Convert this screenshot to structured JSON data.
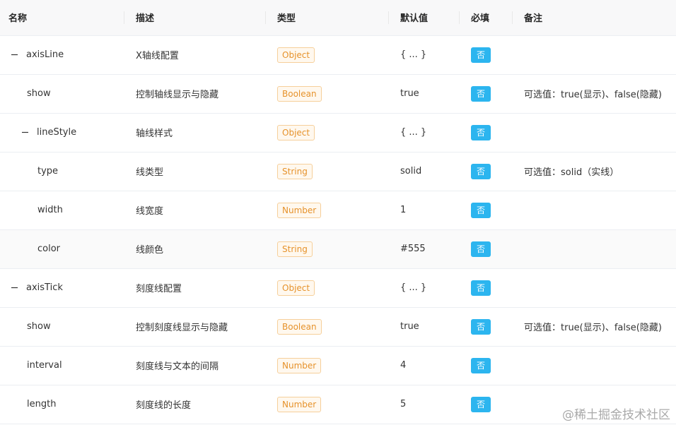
{
  "headers": {
    "name": "名称",
    "description": "描述",
    "type": "类型",
    "default": "默认值",
    "required": "必填",
    "remark": "备注"
  },
  "rows": [
    {
      "name": "axisLine",
      "description": "X轴线配置",
      "type": "Object",
      "default": "{ ... }",
      "required": "否",
      "remark": ""
    },
    {
      "name": "show",
      "description": "控制轴线显示与隐藏",
      "type": "Boolean",
      "default": "true",
      "required": "否",
      "remark": "可选值：true(显示)、false(隐藏)"
    },
    {
      "name": "lineStyle",
      "description": "轴线样式",
      "type": "Object",
      "default": "{ ... }",
      "required": "否",
      "remark": ""
    },
    {
      "name": "type",
      "description": "线类型",
      "type": "String",
      "default": "solid",
      "required": "否",
      "remark": "可选值：solid（实线）"
    },
    {
      "name": "width",
      "description": "线宽度",
      "type": "Number",
      "default": "1",
      "required": "否",
      "remark": ""
    },
    {
      "name": "color",
      "description": "线颜色",
      "type": "String",
      "default": "#555",
      "required": "否",
      "remark": ""
    },
    {
      "name": "axisTick",
      "description": "刻度线配置",
      "type": "Object",
      "default": "{ ... }",
      "required": "否",
      "remark": ""
    },
    {
      "name": "show",
      "description": "控制刻度线显示与隐藏",
      "type": "Boolean",
      "default": "true",
      "required": "否",
      "remark": "可选值：true(显示)、false(隐藏)"
    },
    {
      "name": "interval",
      "description": "刻度线与文本的间隔",
      "type": "Number",
      "default": "4",
      "required": "否",
      "remark": ""
    },
    {
      "name": "length",
      "description": "刻度线的长度",
      "type": "Number",
      "default": "5",
      "required": "否",
      "remark": ""
    }
  ],
  "watermark": "@稀土掘金技术社区",
  "colors": {
    "required_badge": "#2cb5ef",
    "type_tag_text": "#e6922b",
    "type_tag_border": "#f6cf9a",
    "header_bg": "#f8f8f9"
  },
  "icons": {
    "expander": "collapse-minus-icon"
  }
}
